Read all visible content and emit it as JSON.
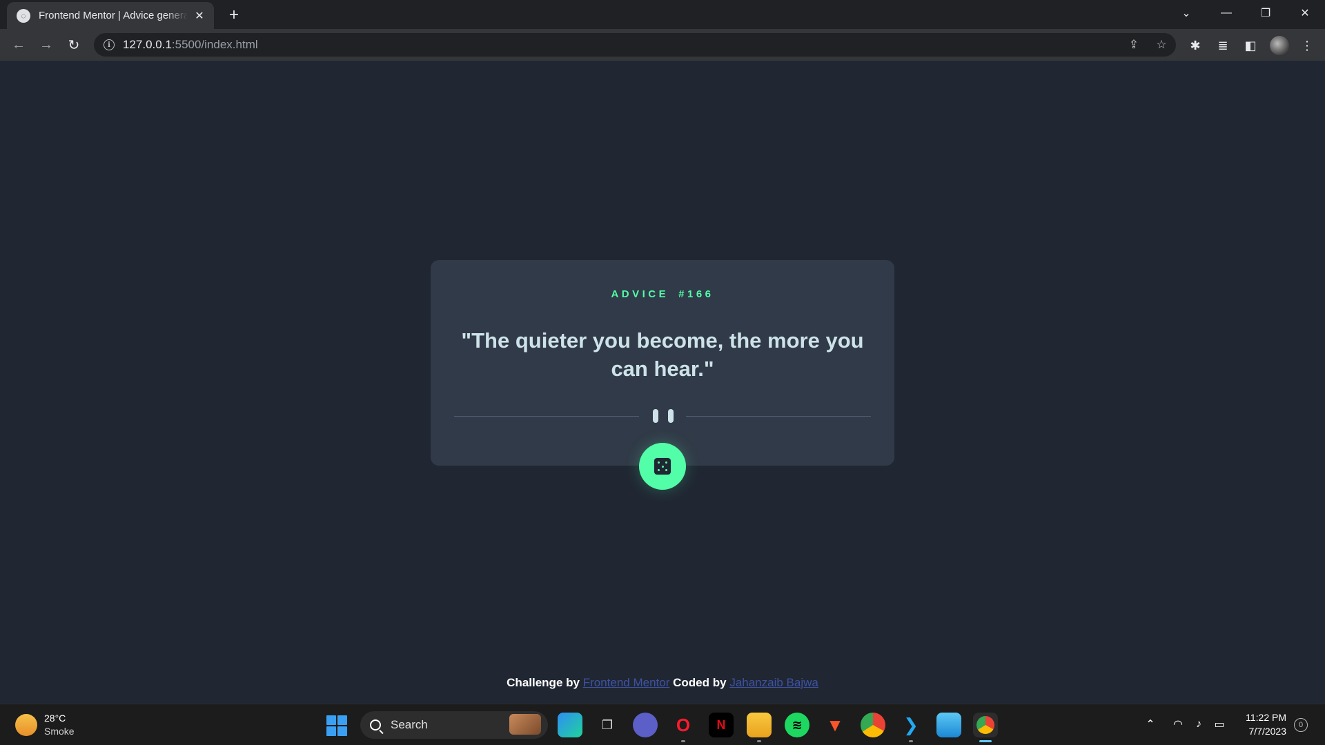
{
  "browser": {
    "tab_title": "Frontend Mentor | Advice generator app",
    "tab_close": "✕",
    "new_tab": "+",
    "url_host": "127.0.0.1",
    "url_rest": ":5500/index.html"
  },
  "advice": {
    "label": "ADVICE",
    "number": "#166",
    "quote": "\"The quieter you become, the more you can hear.\""
  },
  "attribution": {
    "challenge_label": "Challenge by",
    "challenge_link": "Frontend Mentor",
    "coded_label": "Coded by",
    "coded_link": "Jahanzaib Bajwa"
  },
  "taskbar": {
    "weather_temp": "28°C",
    "weather_condition": "Smoke",
    "search_placeholder": "Search",
    "time": "11:22 PM",
    "date": "7/7/2023",
    "notification_count": "0"
  },
  "colors": {
    "page_bg": "#202733",
    "card_bg": "#313a48",
    "accent_green": "#52ffa8",
    "quote_text": "#cee3e9",
    "link": "#3e52a3"
  }
}
